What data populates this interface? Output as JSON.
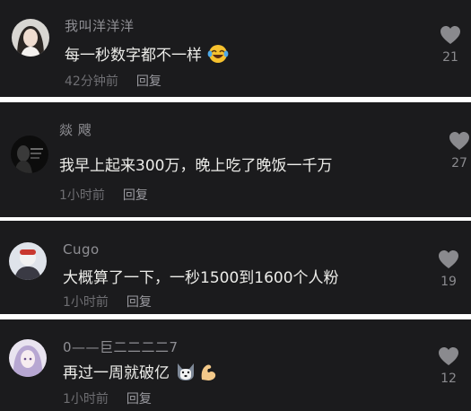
{
  "comments": [
    {
      "username": "我叫洋洋洋",
      "text": "每一秒数字都不一样",
      "time": "42分钟前",
      "reply_label": "回复",
      "likes": "21",
      "emoji": [
        "laughing-tears-emoji"
      ]
    },
    {
      "username": "燚 飕",
      "text": "我早上起来300万，晚上吃了晚饭一千万",
      "time": "1小时前",
      "reply_label": "回复",
      "likes": "27",
      "emoji": []
    },
    {
      "username": "Cugo",
      "text": "大概算了一下，一秒1500到1600个人粉",
      "time": "1小时前",
      "reply_label": "回复",
      "likes": "19",
      "emoji": []
    },
    {
      "username": "0——巨二二二二7",
      "text": "再过一周就破亿",
      "time": "1小时前",
      "reply_label": "回复",
      "likes": "12",
      "emoji": [
        "husky-emoji",
        "flexed-arm-emoji"
      ]
    }
  ],
  "colors": {
    "card_bg": "#1b1b1d",
    "separator": "#ffffff",
    "text": "#ecece9",
    "muted": "#8f8f94",
    "heart": "#8a8a8e"
  }
}
